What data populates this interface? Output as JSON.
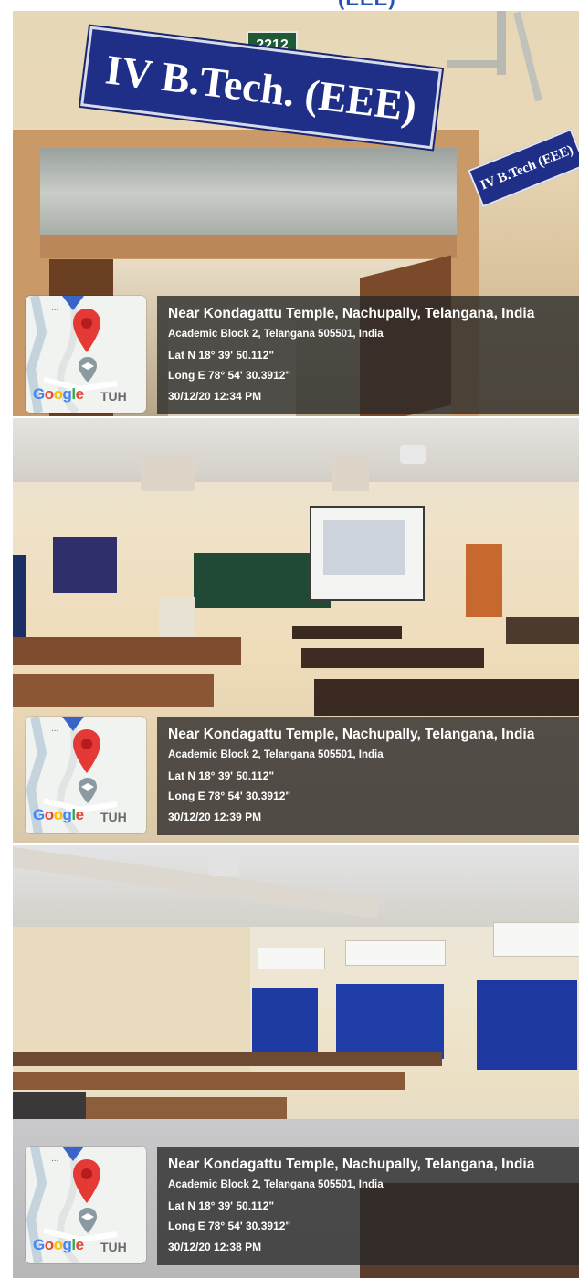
{
  "header": {
    "partial_title": "(EEE)"
  },
  "photos": [
    {
      "caption": {
        "place": "Near Kondagattu Temple, Nachupally, Telangana, India",
        "address": "Academic Block 2, Telangana 505501, India",
        "lat": "Lat N 18° 39' 50.112\"",
        "long": "Long E 78° 54' 30.3912\"",
        "datetime": "30/12/20 12:34 PM"
      },
      "sign_main": "IV B.Tech. (EEE)",
      "sign_room": "2212",
      "sign_side": "IV B.Tech (EEE)"
    },
    {
      "caption": {
        "place": "Near Kondagattu Temple, Nachupally, Telangana, India",
        "address": "Academic Block 2, Telangana 505501, India",
        "lat": "Lat N 18° 39' 50.112\"",
        "long": "Long E 78° 54' 30.3912\"",
        "datetime": "30/12/20 12:39 PM"
      }
    },
    {
      "caption": {
        "place": "Near Kondagattu Temple, Nachupally, Telangana, India",
        "address": "Academic Block 2, Telangana 505501, India",
        "lat": "Lat N 18° 39' 50.112\"",
        "long": "Long E 78° 54' 30.3912\"",
        "datetime": "30/12/20 12:38 PM"
      }
    }
  ],
  "map_card": {
    "brand": "Google",
    "label": "TUH",
    "dots": "...",
    "icons": [
      "map-pin-icon",
      "graduation-cap-icon"
    ]
  },
  "colors": {
    "sign_blue": "#1f2e86",
    "pin_red": "#e53935",
    "overlay": "#282828"
  }
}
